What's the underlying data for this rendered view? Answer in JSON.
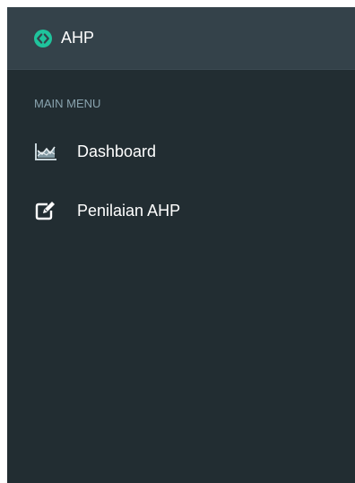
{
  "brand": {
    "title": "AHP",
    "logo_icon": "diamond-chevron-logo",
    "logo_color": "#1fc39c"
  },
  "sidebar": {
    "section_header": "MAIN MENU",
    "items": [
      {
        "label": "Dashboard",
        "icon": "area-chart-icon"
      },
      {
        "label": "Penilaian AHP",
        "icon": "edit-icon"
      }
    ]
  },
  "colors": {
    "sidebar_bg": "#222d32",
    "header_bg": "#34424a",
    "section_text": "#8aa4af",
    "menu_text": "#ffffff"
  }
}
